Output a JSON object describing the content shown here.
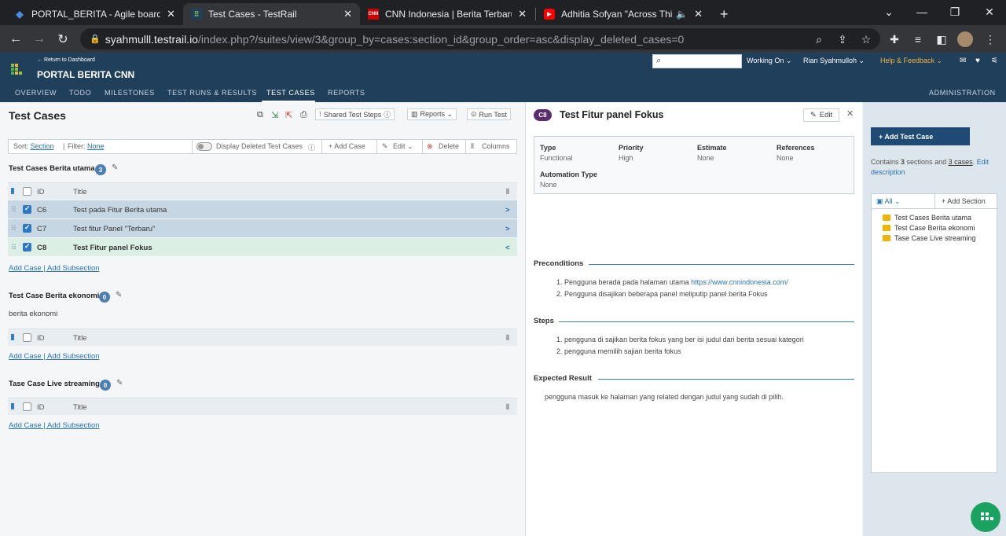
{
  "browser": {
    "tabs": [
      {
        "label": "PORTAL_BERITA - Agile board - Ji",
        "active": false
      },
      {
        "label": "Test Cases - TestRail",
        "active": true
      },
      {
        "label": "CNN Indonesia | Berita Terbaru, T",
        "active": false
      },
      {
        "label": "Adhitia Sofyan \"Across This N",
        "active": false
      }
    ],
    "url_host": "syahmulll.testrail.io",
    "url_path": "/index.php?/suites/view/3&group_by=cases:section_id&group_order=asc&display_deleted_cases=0"
  },
  "header": {
    "return_link": "← Return to Dashboard",
    "project_name": "PORTAL BERITA CNN",
    "working_on": "Working On ⌄",
    "user": "Rian Syahmulloh ⌄",
    "help": "Help & Feedback ⌄",
    "nav": [
      "OVERVIEW",
      "TODO",
      "MILESTONES",
      "TEST RUNS & RESULTS",
      "TEST CASES",
      "REPORTS"
    ],
    "admin": "ADMINISTRATION"
  },
  "left": {
    "title": "Test Cases",
    "shared_steps": "Shared Test Steps",
    "reports": "Reports ⌄",
    "run_test": "Run Test",
    "filter": {
      "sort_label": "Sort:",
      "sort_value": "Section",
      "filter_label": "Filter:",
      "filter_value": "None",
      "display_deleted": "Display Deleted Test Cases",
      "add_case": "+ Add Case",
      "edit": "Edit ⌄",
      "delete": "Delete",
      "columns": "Columns"
    },
    "col_id": "ID",
    "col_title": "Title",
    "add_case_link": "Add Case",
    "add_subsection_link": "Add Subsection",
    "sections": [
      {
        "name": "Test Cases Berita utama",
        "count": "3",
        "description": "",
        "cases": [
          {
            "id": "C6",
            "title": "Test pada Fitur Berita utama",
            "chevron": ">"
          },
          {
            "id": "C7",
            "title": "Test fitur Panel \"Terbaru\"",
            "chevron": ">"
          },
          {
            "id": "C8",
            "title": "Test Fitur panel Fokus",
            "chevron": "<"
          }
        ]
      },
      {
        "name": "Test Case Berita ekonomi",
        "count": "0",
        "description": "berita ekonomi",
        "cases": []
      },
      {
        "name": "Tase Case Live streaming",
        "count": "0",
        "description": "",
        "cases": []
      }
    ]
  },
  "detail": {
    "badge": "C8",
    "title": "Test Fitur panel Fokus",
    "edit": "Edit",
    "fields": {
      "type_label": "Type",
      "type_value": "Functional",
      "priority_label": "Priority",
      "priority_value": "High",
      "estimate_label": "Estimate",
      "estimate_value": "None",
      "references_label": "References",
      "references_value": "None",
      "automation_label": "Automation Type",
      "automation_value": "None"
    },
    "preconditions_label": "Preconditions",
    "preconditions": [
      {
        "text": "1. Pengguna berada pada halaman utama ",
        "link": "https://www.cnnindonesia.com/"
      },
      {
        "text": "2. Pengguna disajikan beberapa panel meliputip panel berita Fokus",
        "link": ""
      }
    ],
    "steps_label": "Steps",
    "steps": [
      "1. pengguna di sajikan berita fokus yang ber isi judul dari berita sesuai kategori",
      "2. pengguna memilih sajian berita fokus"
    ],
    "expected_label": "Expected Result",
    "expected": "pengguna masuk ke halaman yang related dengan judul yang sudah di pilih."
  },
  "sidebar": {
    "add_test_case": "+ Add Test Case",
    "contains_pre": "Contains ",
    "sections_count": "3",
    "contains_mid": " sections and ",
    "cases_count": "3 cases",
    "contains_post": ". ",
    "edit_description": "Edit description",
    "tree_all": "All ⌄",
    "add_section": "+ Add Section",
    "tree": [
      "Test Cases Berita utama",
      "Test Case Berita ekonomi",
      "Tase Case Live streaming"
    ]
  },
  "colors": {
    "header": "#1f3f5b",
    "accent": "#2873b5",
    "badge": "#4a7fb5",
    "selected_row": "#dbefe4"
  }
}
